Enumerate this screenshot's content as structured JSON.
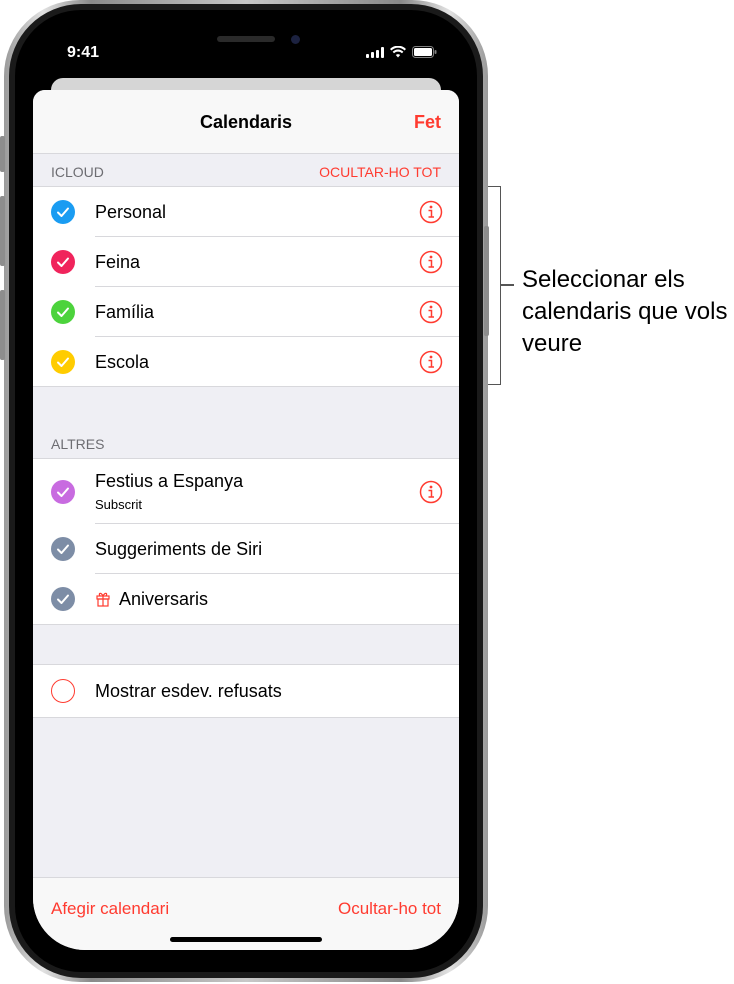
{
  "status_bar": {
    "time": "9:41"
  },
  "nav": {
    "title": "Calendaris",
    "done_label": "Fet"
  },
  "icloud": {
    "header": "ICLOUD",
    "action": "OCULTAR-HO TOT",
    "items": [
      {
        "label": "Personal",
        "color": "#1a9cf2"
      },
      {
        "label": "Feina",
        "color": "#f0245c"
      },
      {
        "label": "Família",
        "color": "#4cd33c"
      },
      {
        "label": "Escola",
        "color": "#ffcc00"
      }
    ]
  },
  "others": {
    "header": "ALTRES",
    "items": [
      {
        "label": "Festius a Espanya",
        "sublabel": "Subscrit",
        "color": "#c86be0"
      },
      {
        "label": "Suggeriments de Siri",
        "color": "#7d8da6"
      },
      {
        "label": "Aniversaris",
        "color": "#7d8da6",
        "icon": "gift-icon"
      }
    ]
  },
  "declined": {
    "label": "Mostrar esdev. refusats",
    "color": "#ff3b30"
  },
  "footer": {
    "add_label": "Afegir calendari",
    "hide_label": "Ocultar-ho tot"
  },
  "annotation": {
    "text": "Seleccionar els calendaris que vols veure"
  },
  "colors": {
    "accent": "#ff3b30",
    "separator": "#d8d8dc",
    "background": "#efeff4"
  }
}
